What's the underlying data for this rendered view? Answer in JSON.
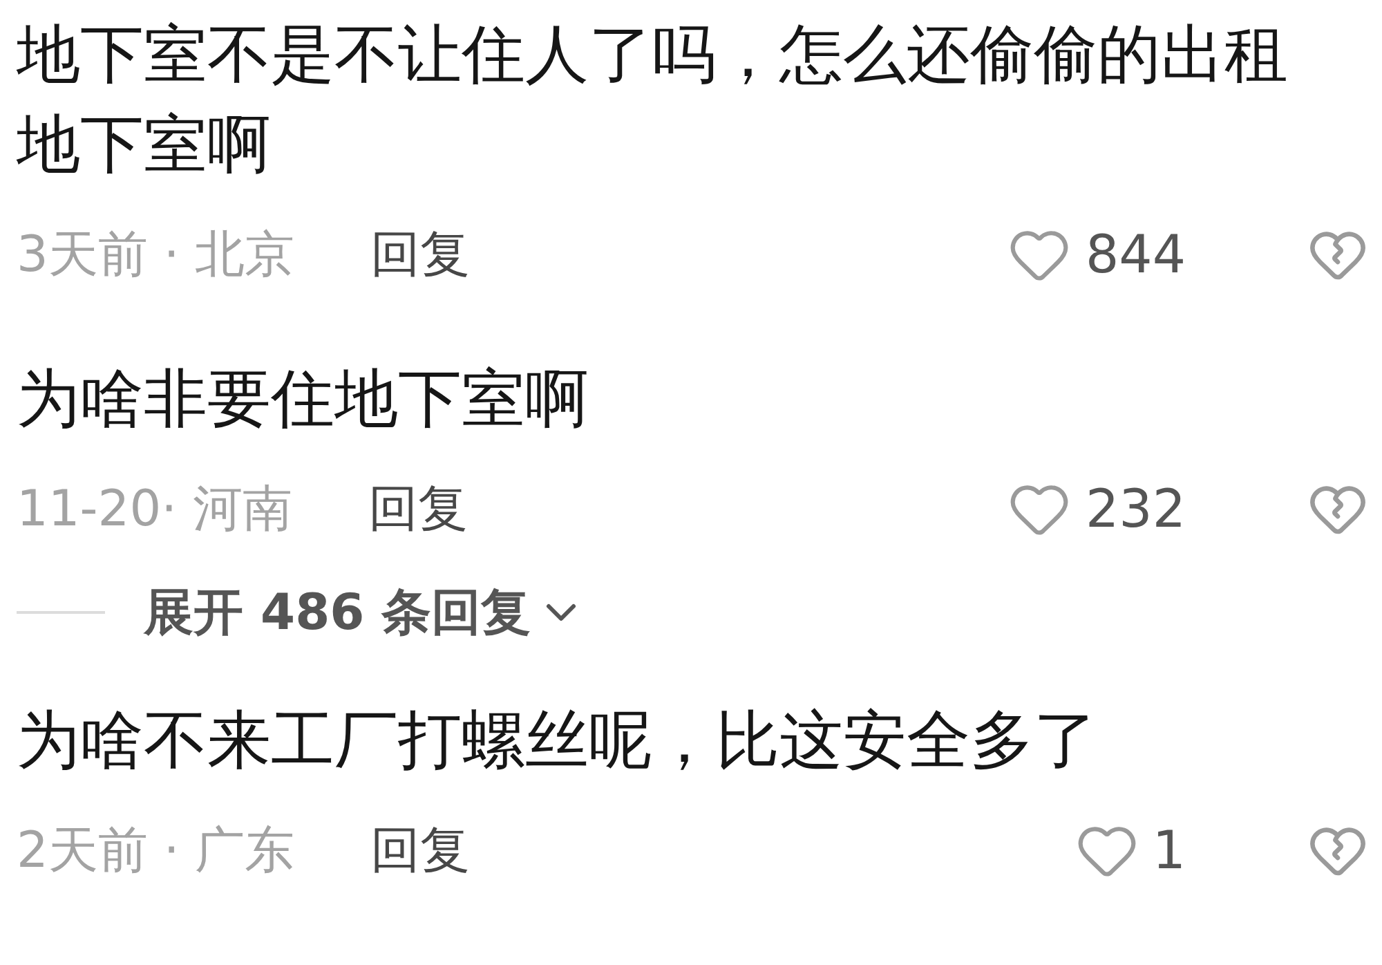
{
  "items": [
    {
      "kind": "comment",
      "text": "地下室不是不让住人了吗，怎么还偷偷的出租地下室啊",
      "meta": "3天前 · 北京",
      "reply": "回复",
      "likes": "844"
    },
    {
      "kind": "comment",
      "text": "为啥非要住地下室啊",
      "meta": "11-20· 河南",
      "reply": "回复",
      "likes": "232"
    },
    {
      "kind": "expand",
      "label": "展开 486 条回复"
    },
    {
      "kind": "comment",
      "text": "为啥不来工厂打螺丝呢，比这安全多了",
      "meta": "2天前 · 广东",
      "reply": "回复",
      "likes": "1"
    }
  ]
}
